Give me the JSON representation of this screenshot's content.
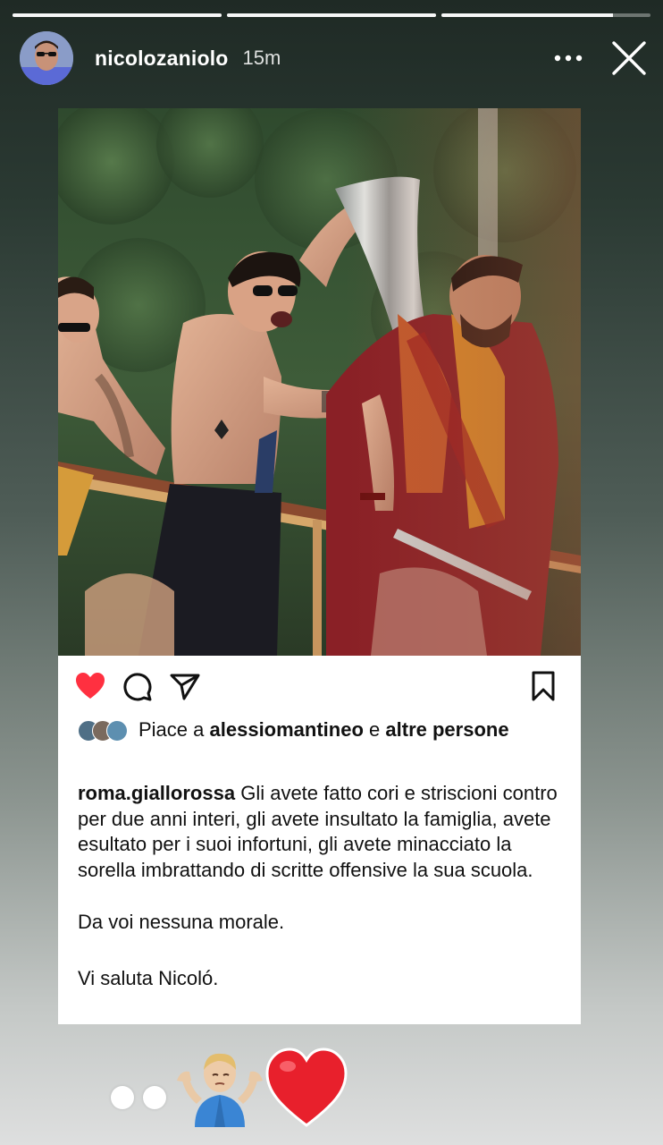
{
  "story": {
    "progress": [
      1.0,
      1.0,
      0.82
    ],
    "username": "nicolozaniolo",
    "timestamp": "15m",
    "more_icon": "more-horizontal-icon",
    "close_icon": "close-icon"
  },
  "post": {
    "liked": true,
    "like_color": "#ff3040",
    "icons": [
      "heart-icon",
      "comment-icon",
      "share-icon",
      "bookmark-icon"
    ],
    "likes_prefix": "Piace a",
    "likes_user": "alessiomantineo",
    "likes_mid": "e",
    "likes_suffix": "altre persone",
    "caption_author": "roma.giallorossa",
    "caption_text": "Gli avete fatto cori e striscioni contro per due anni interi, gli avete insultato la famiglia, avete esultato per i suoi infortuni, gli avete minacciato la sorella imbrattando di scritte offensive la sua scuola.",
    "caption_para2": "Da voi nessuna morale.",
    "caption_para3": "Vi saluta Nicoló."
  },
  "stickers": [
    "dots",
    "person-shrugging-emoji",
    "red-heart-emoji"
  ]
}
